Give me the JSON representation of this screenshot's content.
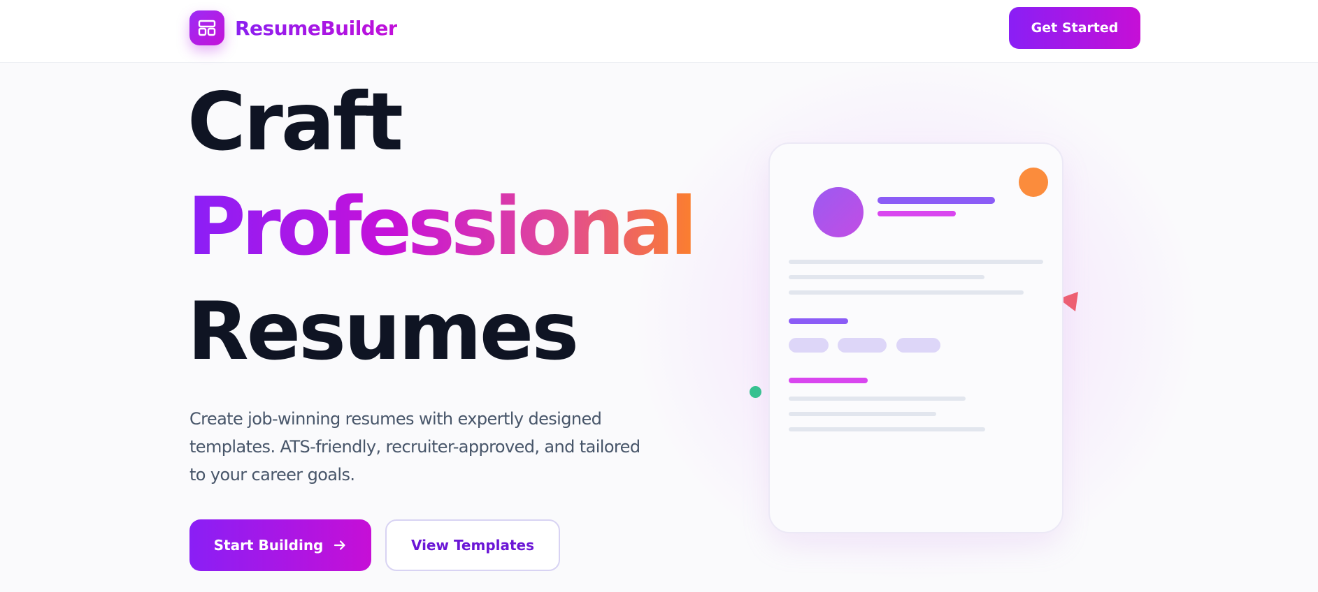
{
  "header": {
    "logo_text": "ResumeBuilder",
    "logo_icon": "layout-template-icon",
    "cta_label": "Get Started"
  },
  "hero": {
    "title_line1": "Craft",
    "title_line2": "Professional",
    "title_line3": "Resumes",
    "subtitle": "Create job-winning resumes with expertly designed templates. ATS-friendly, recruiter-approved, and tailored to your career goals.",
    "primary_button": "Start Building",
    "primary_button_icon": "arrow-right-icon",
    "secondary_button": "View Templates"
  },
  "colors": {
    "brand_purple": "#8a1ff5",
    "brand_magenta": "#c60fd6",
    "accent_orange": "#fb8c3c",
    "accent_red": "#ef5d6e",
    "accent_green": "#34c38f",
    "title_dark": "#0f1423"
  }
}
